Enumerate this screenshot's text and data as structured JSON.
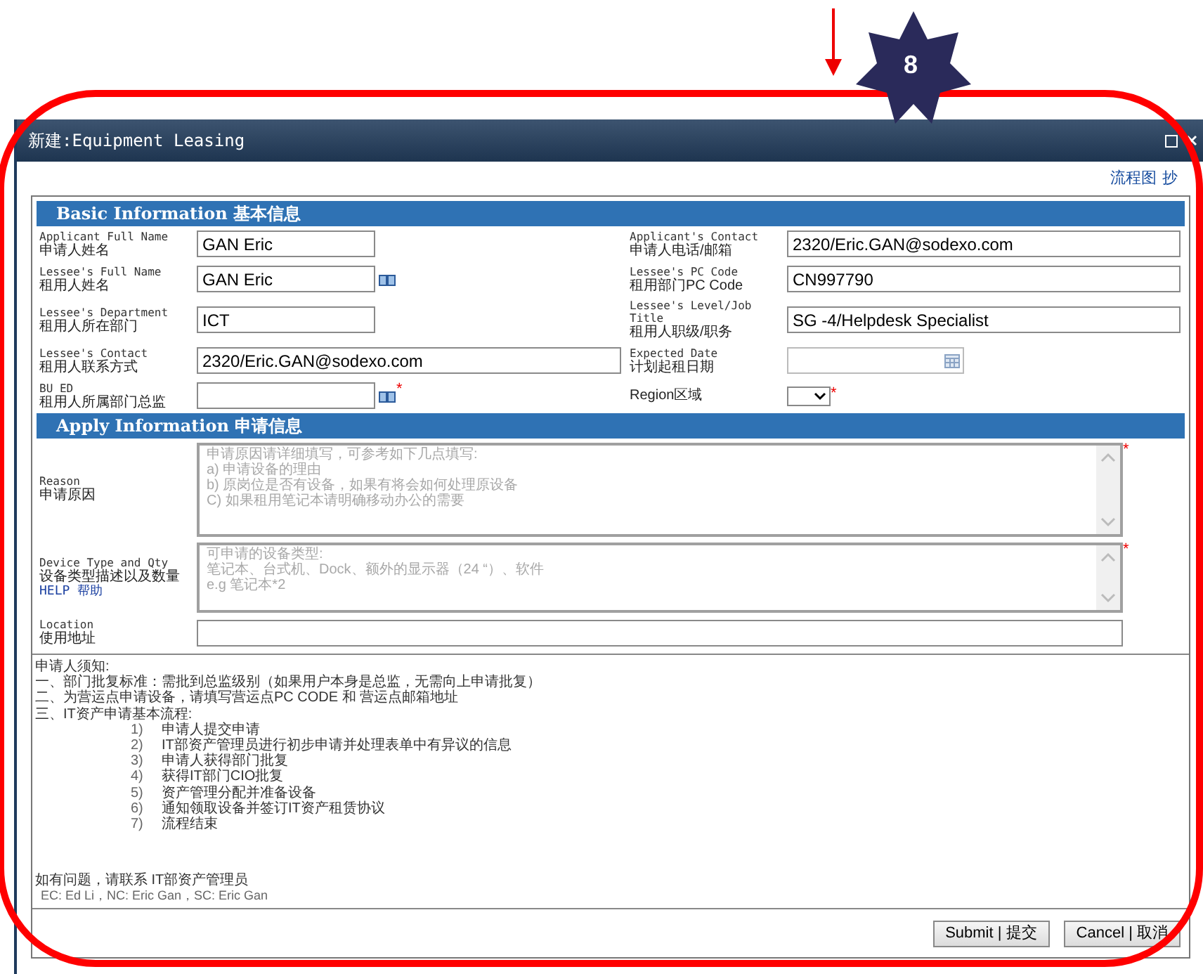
{
  "annotation": {
    "badge": "8"
  },
  "window": {
    "title": "新建:Equipment Leasing"
  },
  "toolbar_links": [
    "流程图",
    "抄"
  ],
  "basic": {
    "title": "Basic Information 基本信息",
    "rows": [
      {
        "left": {
          "label_en": "Applicant Full Name",
          "label_zh": "申请人姓名",
          "value": "GAN Eric",
          "kind": "text",
          "wide": false
        },
        "right": {
          "label_en": "Applicant's Contact",
          "label_zh": "申请人电话/邮箱",
          "value": "2320/Eric.GAN@sodexo.com",
          "kind": "text"
        }
      },
      {
        "left": {
          "label_en": "Lessee's Full Name",
          "label_zh": "租用人姓名",
          "value": "GAN Eric",
          "kind": "lookup",
          "wide": false
        },
        "right": {
          "label_en": "Lessee's PC Code",
          "label_zh": "租用部门PC Code",
          "value": "CN997790",
          "kind": "text"
        }
      },
      {
        "left": {
          "label_en": "Lessee's Department",
          "label_zh": "租用人所在部门",
          "value": "ICT",
          "kind": "text",
          "wide": false
        },
        "right": {
          "label_en": "Lessee's Level/Job Title",
          "label_zh": "租用人职级/职务",
          "value": "SG -4/Helpdesk Specialist",
          "kind": "text"
        }
      },
      {
        "left": {
          "label_en": "Lessee's Contact",
          "label_zh": "租用人联系方式",
          "value": "2320/Eric.GAN@sodexo.com",
          "kind": "text",
          "wide": true
        },
        "right": {
          "label_en": "Expected Date",
          "label_zh": "计划起租日期",
          "kind": "date"
        }
      },
      {
        "left": {
          "label_en": "BU ED",
          "label_zh": "租用人所属部门总监",
          "kind": "lookup",
          "wide": false,
          "required_mark": "*"
        },
        "right": {
          "label_zh": "Region区域",
          "kind": "select",
          "required_mark": "*"
        }
      }
    ]
  },
  "apply": {
    "title": "Apply Information 申请信息",
    "fields": [
      {
        "label_en": "Reason",
        "label_zh": "申请原因",
        "kind": "textarea",
        "placeholder": "申请原因请详细填写，可参考如下几点填写:\na) 申请设备的理由\nb) 原岗位是否有设备，如果有将会如何处理原设备\nC) 如果租用笔记本请明确移动办公的需要",
        "required_mark": "*"
      },
      {
        "label_en": "Device Type and Qty",
        "label_zh": "设备类型描述以及数量",
        "help": "HELP 帮助",
        "kind": "textarea",
        "placeholder": "可申请的设备类型:\n笔记本、台式机、Dock、额外的显示器（24 “）、软件\ne.g 笔记本*2",
        "required_mark": "*"
      },
      {
        "label_en": "Location",
        "label_zh": "使用地址",
        "kind": "text"
      }
    ]
  },
  "notice": {
    "title": "申请人须知:",
    "lines": [
      "一、部门批复标准：需批到总监级别（如果用户本身是总监，无需向上申请批复）",
      "二、为营运点申请设备，请填写营运点PC CODE 和 营运点邮箱地址",
      "三、IT资产申请基本流程:"
    ],
    "steps": [
      {
        "number": "1)",
        "text": "申请人提交申请"
      },
      {
        "number": "2)",
        "text": "IT部资产管理员进行初步申请并处理表单中有异议的信息"
      },
      {
        "number": "3)",
        "text": "申请人获得部门批复"
      },
      {
        "number": "4)",
        "text": "获得IT部门CIO批复"
      },
      {
        "number": "5)",
        "text": "资产管理分配并准备设备"
      },
      {
        "number": "6)",
        "text": "通知领取设备并签订IT资产租赁协议"
      },
      {
        "number": "7)",
        "text": "流程结束"
      }
    ],
    "contact": "如有问题，请联系 IT部资产管理员",
    "contacts_detail": "EC:  Ed Li，NC: Eric Gan，SC: Eric Gan"
  },
  "buttons": [
    "Submit | 提交",
    "Cancel | 取消"
  ]
}
